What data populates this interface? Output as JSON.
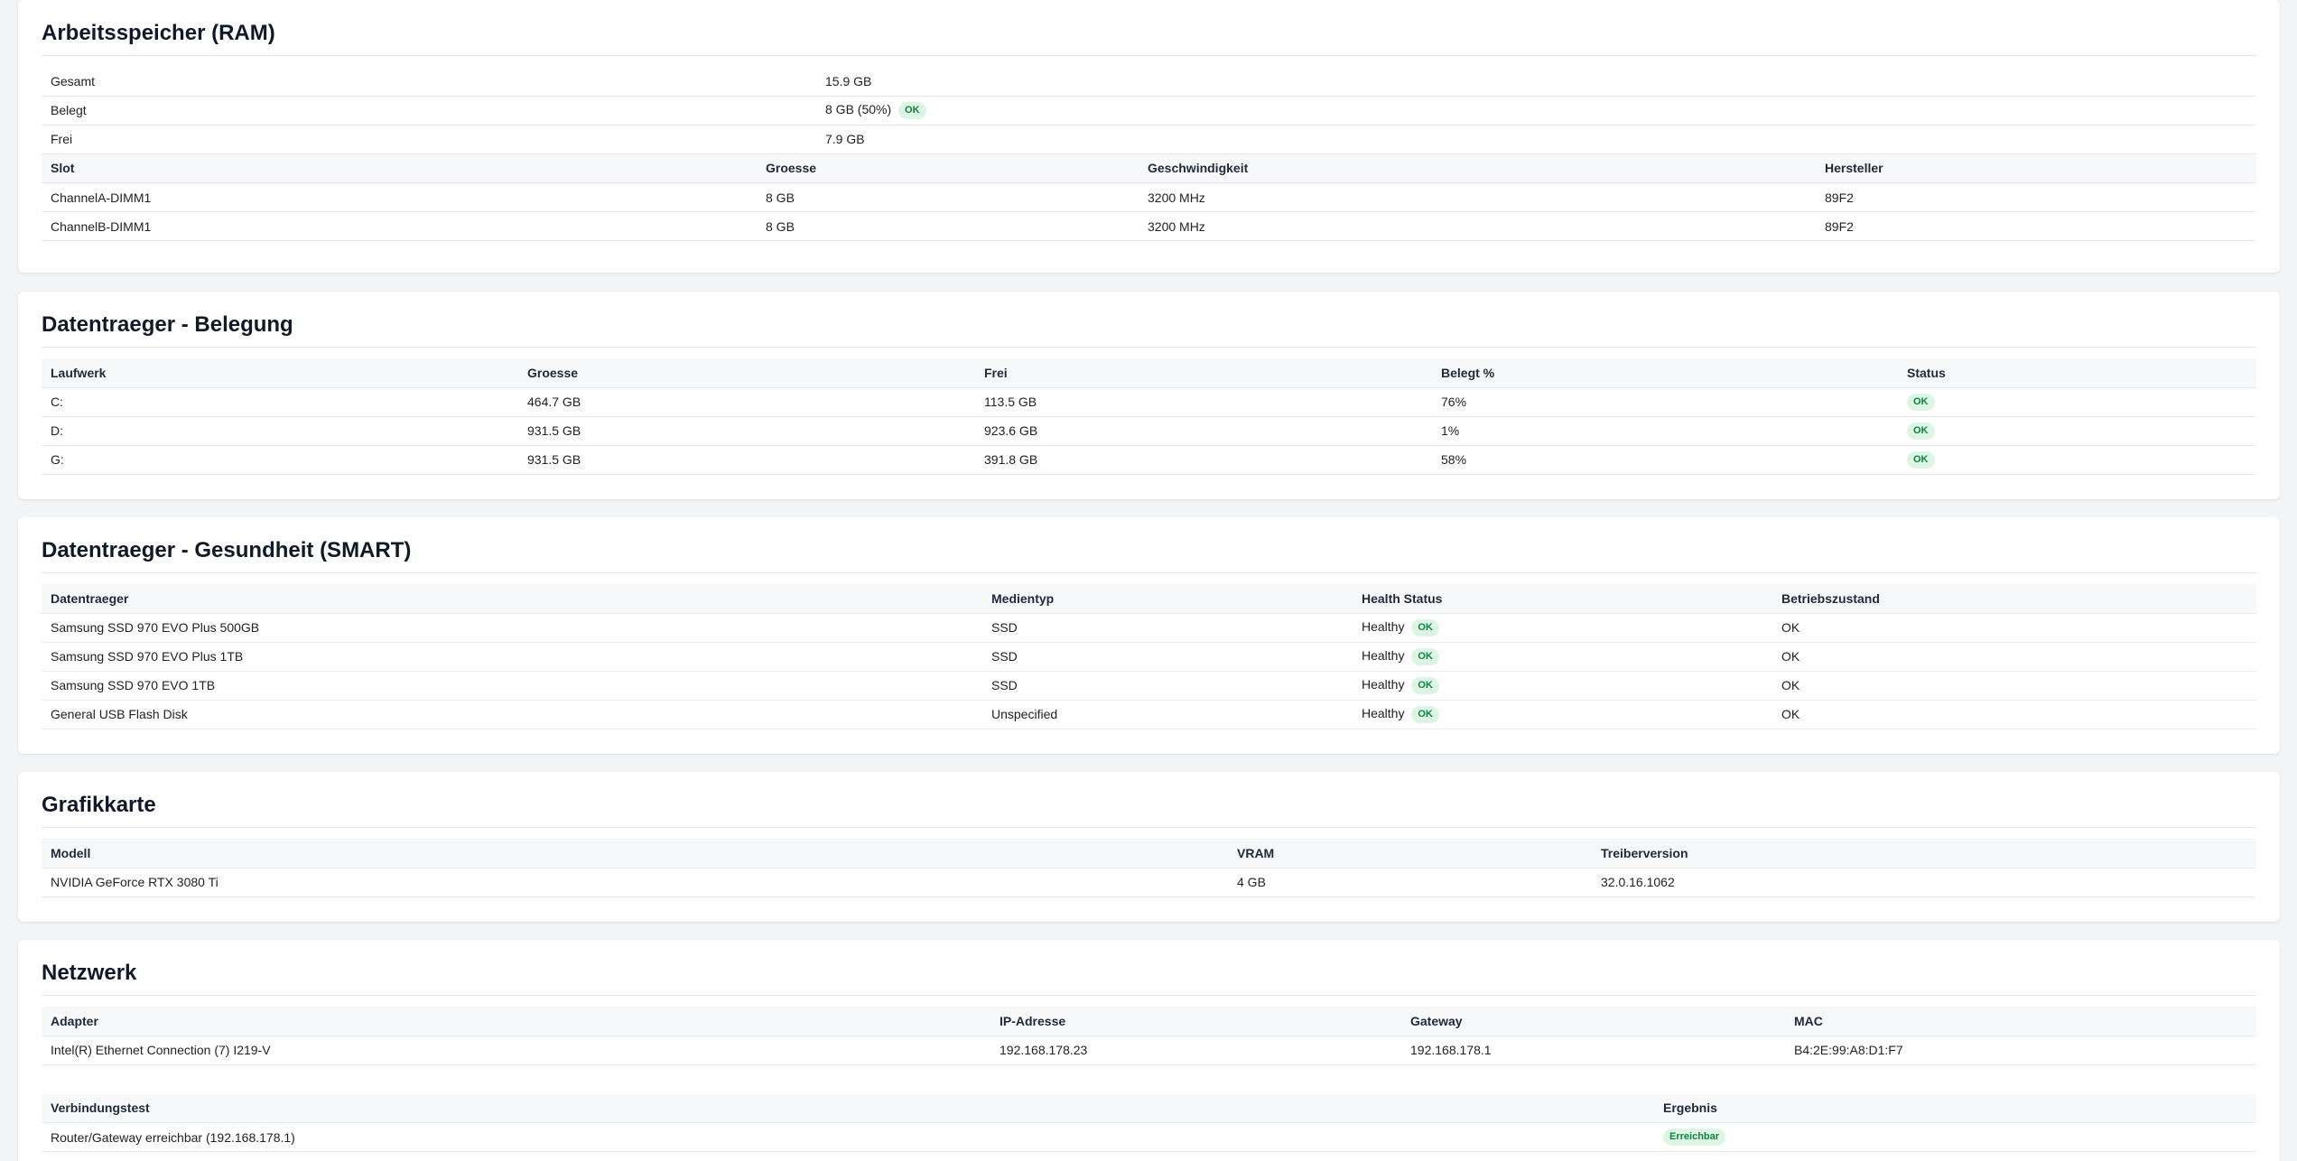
{
  "ram": {
    "title": "Arbeitsspeicher (RAM)",
    "summary": [
      {
        "label": "Gesamt",
        "value": "15.9 GB",
        "badge": ""
      },
      {
        "label": "Belegt",
        "value": "8 GB (50%)",
        "badge": "OK"
      },
      {
        "label": "Frei",
        "value": "7.9 GB",
        "badge": ""
      }
    ],
    "headers": [
      "Slot",
      "Groesse",
      "Geschwindigkeit",
      "Hersteller"
    ],
    "rows": [
      [
        "ChannelA-DIMM1",
        "8 GB",
        "3200 MHz",
        "89F2"
      ],
      [
        "ChannelB-DIMM1",
        "8 GB",
        "3200 MHz",
        "89F2"
      ]
    ]
  },
  "disks": {
    "title": "Datentraeger - Belegung",
    "headers": [
      "Laufwerk",
      "Groesse",
      "Frei",
      "Belegt %",
      "Status"
    ],
    "rows": [
      [
        "C:",
        "464.7 GB",
        "113.5 GB",
        "76%",
        "OK"
      ],
      [
        "D:",
        "931.5 GB",
        "923.6 GB",
        "1%",
        "OK"
      ],
      [
        "G:",
        "931.5 GB",
        "391.8 GB",
        "58%",
        "OK"
      ]
    ]
  },
  "smart": {
    "title": "Datentraeger - Gesundheit (SMART)",
    "headers": [
      "Datentraeger",
      "Medientyp",
      "Health Status",
      "Betriebszustand"
    ],
    "rows": [
      [
        "Samsung SSD 970 EVO Plus 500GB",
        "SSD",
        "Healthy",
        "OK",
        "OK"
      ],
      [
        "Samsung SSD 970 EVO Plus 1TB",
        "SSD",
        "Healthy",
        "OK",
        "OK"
      ],
      [
        "Samsung SSD 970 EVO 1TB",
        "SSD",
        "Healthy",
        "OK",
        "OK"
      ],
      [
        "General USB Flash Disk",
        "Unspecified",
        "Healthy",
        "OK",
        "OK"
      ]
    ]
  },
  "gpu": {
    "title": "Grafikkarte",
    "headers": [
      "Modell",
      "VRAM",
      "Treiberversion"
    ],
    "rows": [
      [
        "NVIDIA GeForce RTX 3080 Ti",
        "4 GB",
        "32.0.16.1062"
      ]
    ]
  },
  "network": {
    "title": "Netzwerk",
    "headers": [
      "Adapter",
      "IP-Adresse",
      "Gateway",
      "MAC"
    ],
    "rows": [
      [
        "Intel(R) Ethernet Connection (7) I219-V",
        "192.168.178.23",
        "192.168.178.1",
        "B4:2E:99:A8:D1:F7"
      ]
    ],
    "test_headers": [
      "Verbindungstest",
      "Ergebnis"
    ],
    "test_rows": [
      [
        "Router/Gateway erreichbar (192.168.178.1)",
        "Erreichbar"
      ]
    ]
  },
  "colors": {
    "badge_bg": "#dcf5e4",
    "badge_text": "#15803d",
    "page_bg": "#f3f4f6"
  }
}
